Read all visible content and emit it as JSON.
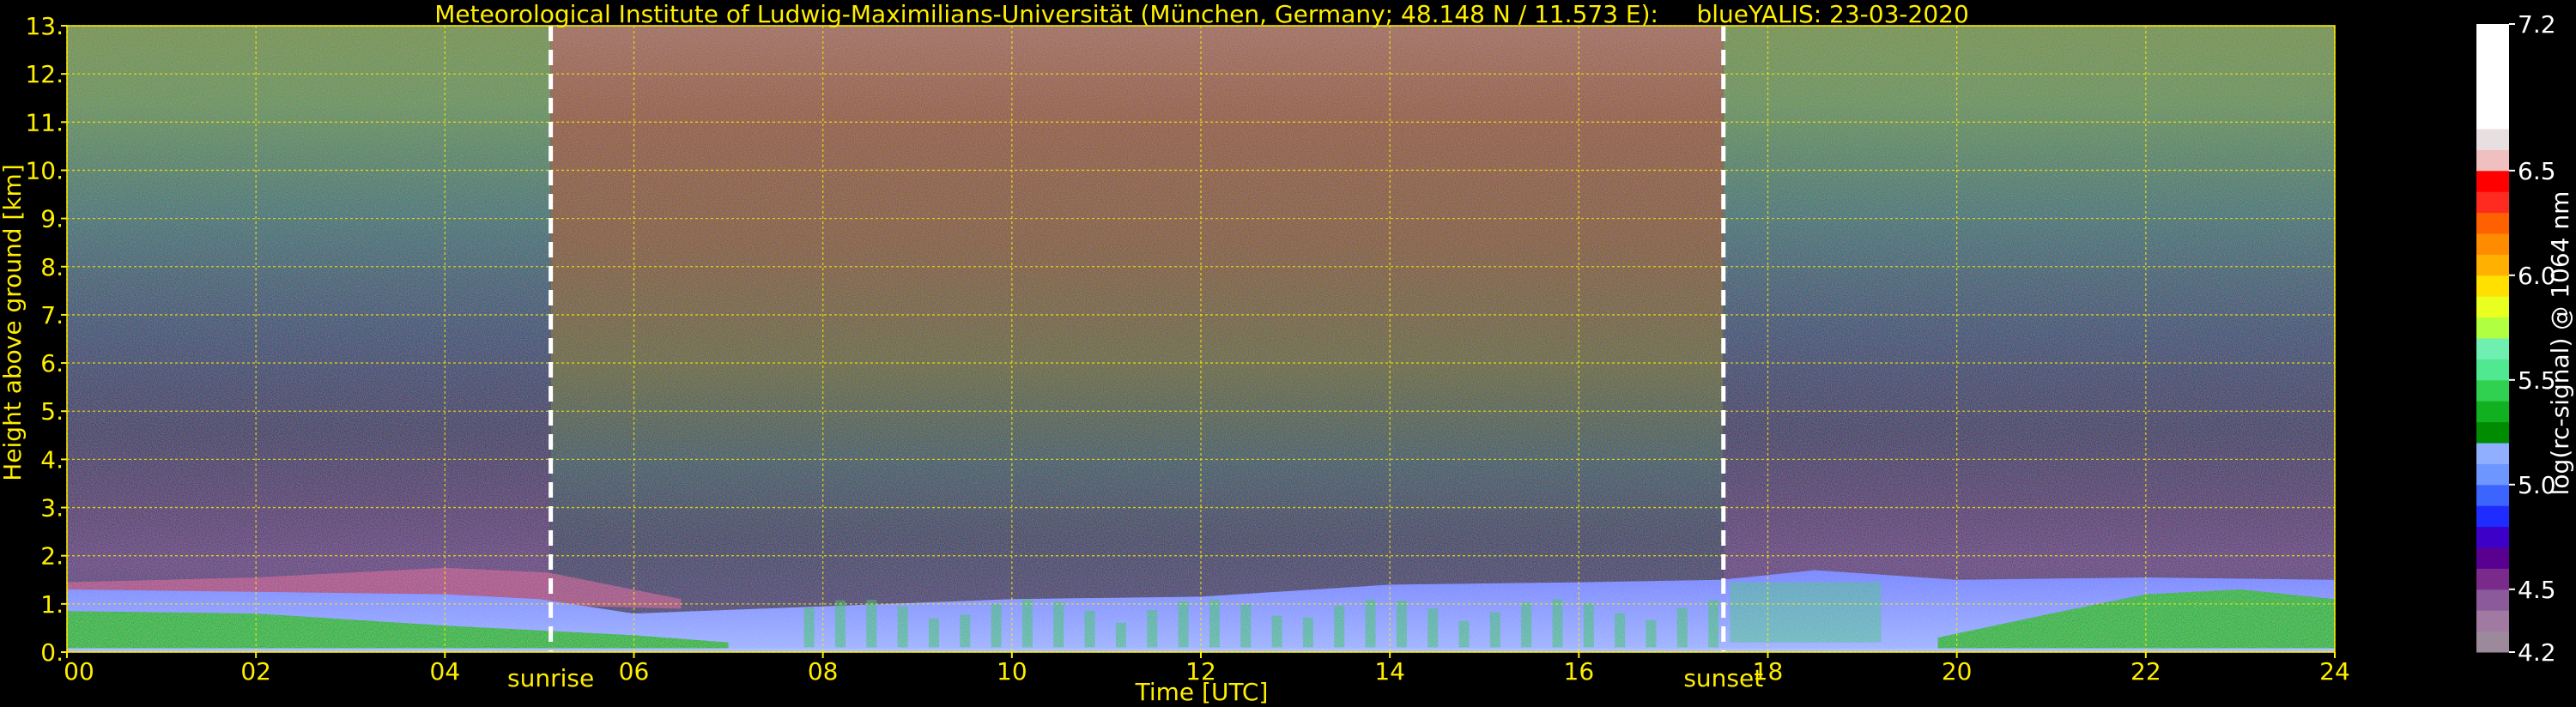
{
  "chart_data": {
    "type": "heatmap",
    "title": "Meteorological Institute of Ludwig-Maximilians-Universität (München, Germany; 48.148 N / 11.573 E):     blueYALIS: 23-03-2020",
    "xlabel": "Time [UTC]",
    "ylabel": "Height above ground [km]",
    "xlim": [
      0,
      24
    ],
    "ylim": [
      0,
      13
    ],
    "x_ticks": [
      0,
      2,
      4,
      6,
      8,
      10,
      12,
      14,
      16,
      18,
      20,
      22,
      24
    ],
    "x_tick_labels": [
      "00",
      "02",
      "04",
      "06",
      "08",
      "10",
      "12",
      "14",
      "16",
      "18",
      "20",
      "22",
      "24"
    ],
    "y_ticks": [
      0,
      1,
      2,
      3,
      4,
      5,
      6,
      7,
      8,
      9,
      10,
      11,
      12,
      13
    ],
    "y_tick_labels": [
      "0.",
      "1.",
      "2.",
      "3.",
      "4.",
      "5.",
      "6.",
      "7.",
      "8.",
      "9.",
      "10.",
      "11.",
      "12.",
      "13."
    ],
    "grid": true,
    "markers": [
      {
        "label": "sunrise",
        "time": 5.12
      },
      {
        "label": "sunset",
        "time": 17.53
      }
    ],
    "colorbar": {
      "label": "log(rc-signal) @ 1064 nm",
      "min": 4.2,
      "max": 7.2,
      "tick_labels": [
        "4.2",
        "4.5",
        "5.0",
        "5.5",
        "6.0",
        "6.5",
        "7.2"
      ],
      "ticks": [
        4.2,
        4.5,
        5.0,
        5.5,
        6.0,
        6.5,
        7.2
      ],
      "colors": [
        "#9c8a9c",
        "#a07aa0",
        "#8a5a9a",
        "#7a2a8a",
        "#5a0090",
        "#3c00c8",
        "#1e2cff",
        "#3c64ff",
        "#6e96ff",
        "#90b0ff",
        "#008c00",
        "#10b020",
        "#30d050",
        "#50e890",
        "#70f0b0",
        "#b0ff40",
        "#e8ff20",
        "#ffe000",
        "#ffb000",
        "#ff8c00",
        "#ff6000",
        "#ff2a20",
        "#ff0000",
        "#f0c0c0",
        "#e8e0e0",
        "#ffffff",
        "#ffffff",
        "#ffffff",
        "#ffffff",
        "#ffffff"
      ]
    }
  }
}
